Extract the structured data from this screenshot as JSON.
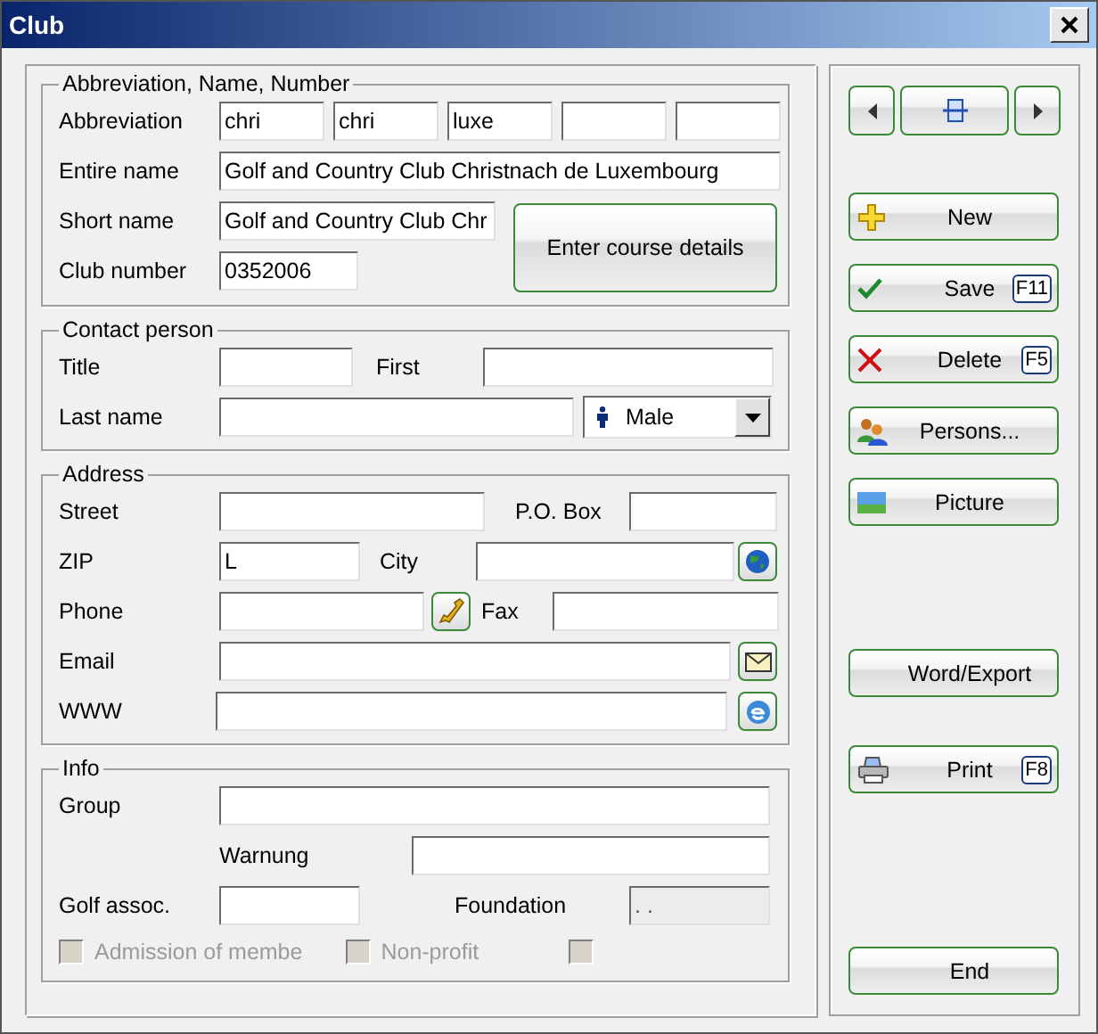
{
  "window": {
    "title": "Club"
  },
  "identity": {
    "legend": "Abbreviation, Name, Number",
    "abbreviation_label": "Abbreviation",
    "abbreviations": [
      "chri",
      "chri",
      "luxe"
    ],
    "entire_name_label": "Entire name",
    "entire_name": "Golf and Country Club Christnach de Luxembourg",
    "short_name_label": "Short name",
    "short_name": "Golf and Country Club Chr",
    "club_number_label": "Club number",
    "club_number": "0352006",
    "course_button": "Enter course details"
  },
  "contact": {
    "legend": "Contact person",
    "title_label": "Title",
    "first_label": "First",
    "last_name_label": "Last name",
    "gender": "Male"
  },
  "address": {
    "legend": "Address",
    "street_label": "Street",
    "po_box_label": "P.O. Box",
    "zip_label": "ZIP",
    "zip": "L",
    "city_label": "City",
    "phone_label": "Phone",
    "fax_label": "Fax",
    "email_label": "Email",
    "www_label": "WWW"
  },
  "info": {
    "legend": "Info",
    "group_label": "Group",
    "warning_label": "Warnung",
    "golf_assoc_label": "Golf assoc.",
    "foundation_label": "Foundation",
    "foundation": ". .",
    "checkboxes": [
      {
        "label": "Admission of membe",
        "checked": false,
        "disabled": true
      },
      {
        "label": "Non-profit",
        "checked": false,
        "disabled": true
      },
      {
        "checked": false,
        "disabled": true
      }
    ]
  },
  "actions": [
    {
      "kind": "plus",
      "label": "New"
    },
    {
      "kind": "check",
      "label": "Save",
      "shortcut": "F11"
    },
    {
      "kind": "cross",
      "label": "Delete",
      "shortcut": "F5"
    },
    {
      "kind": "people",
      "label": "Persons..."
    },
    {
      "kind": "picture",
      "label": "Picture"
    },
    {
      "kind": "plain",
      "label": "Word/Export"
    },
    {
      "kind": "printer",
      "label": "Print",
      "shortcut": "F8"
    },
    {
      "kind": "plain",
      "label": "End"
    }
  ]
}
